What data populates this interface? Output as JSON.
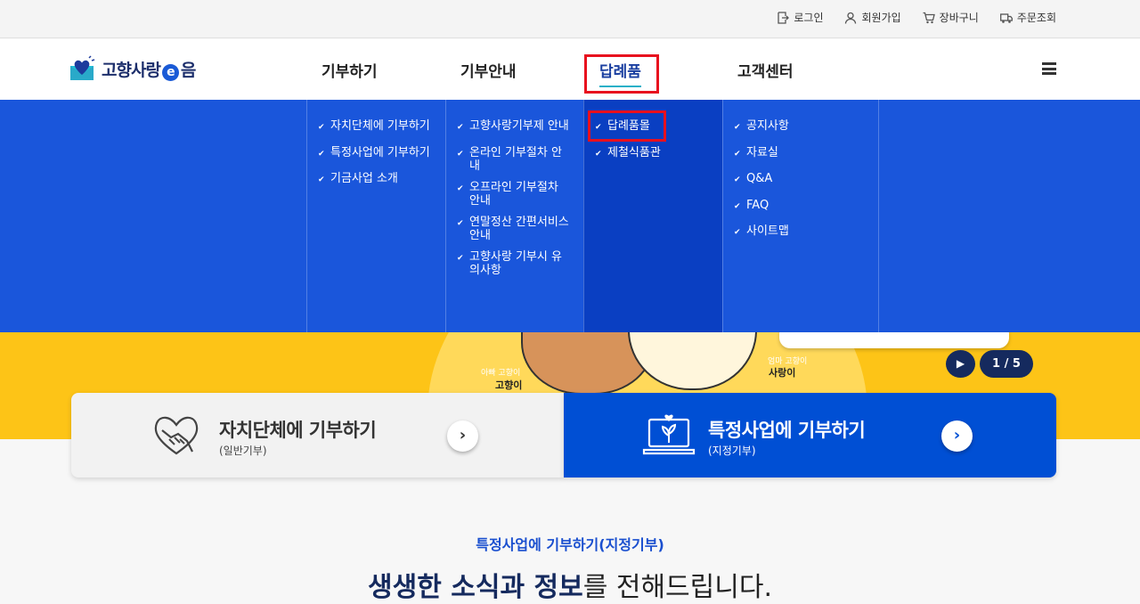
{
  "topbar": {
    "links": [
      {
        "label": "로그인",
        "icon": "login-icon"
      },
      {
        "label": "회원가입",
        "icon": "user-icon"
      },
      {
        "label": "장바구니",
        "icon": "cart-icon"
      },
      {
        "label": "주문조회",
        "icon": "truck-icon"
      }
    ]
  },
  "header": {
    "logo": {
      "part1": "고향사랑",
      "e": "e",
      "part2": "음"
    },
    "nav": [
      {
        "label": "기부하기"
      },
      {
        "label": "기부안내"
      },
      {
        "label": "답례품",
        "active": true
      },
      {
        "label": "고객센터"
      }
    ]
  },
  "mega_menu": {
    "columns": [
      {
        "items": [
          "자치단체에 기부하기",
          "특정사업에 기부하기",
          "기금사업 소개"
        ]
      },
      {
        "items": [
          "고향사랑기부제 안내",
          "온라인 기부절차 안내",
          "오프라인 기부절차 안내",
          "연말정산 간편서비스 안내",
          "고향사랑 기부시 유의사항"
        ]
      },
      {
        "items": [
          "답례품몰",
          "제철식품관"
        ]
      },
      {
        "items": [
          "공지사항",
          "자료실",
          "Q&A",
          "FAQ",
          "사이트맵"
        ]
      }
    ]
  },
  "hero": {
    "char1_small": "아빠 고향이",
    "char1_name": "고향이",
    "char2_small": "엄마 고향이",
    "char2_name": "사랑이",
    "pager": "1 / 5"
  },
  "cards": {
    "left": {
      "title": "자치단체에 기부하기",
      "sub": "(일반기부)"
    },
    "right": {
      "title": "특정사업에 기부하기",
      "sub": "(지정기부)"
    }
  },
  "section": {
    "subtitle": "특정사업에 기부하기(지정기부)",
    "title_bold": "생생한 소식과 정보",
    "title_rest": "를 전해드립니다."
  },
  "colors": {
    "brand_blue": "#1a56db",
    "brand_navy": "#152a5e",
    "highlight": "#e8101e",
    "hero_yellow": "#fdc417"
  }
}
